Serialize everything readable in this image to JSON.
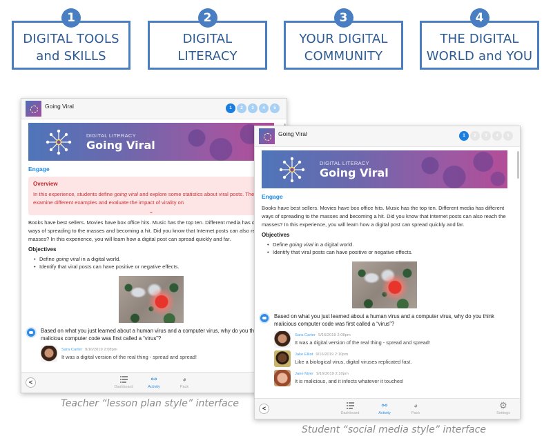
{
  "units": [
    {
      "number": "1",
      "line1": "DIGITAL TOOLS",
      "line2": "and SKILLS"
    },
    {
      "number": "2",
      "line1": "DIGITAL",
      "line2": "LITERACY"
    },
    {
      "number": "3",
      "line1": "YOUR DIGITAL",
      "line2": "COMMUNITY"
    },
    {
      "number": "4",
      "line1": "THE DIGITAL",
      "line2": "WORLD and YOU"
    }
  ],
  "colors": {
    "unit_border": "#4a7ec2",
    "accent_blue": "#1f8ae6",
    "overview_bg": "#fde5e6",
    "overview_text": "#cc3339"
  },
  "lesson": {
    "title": "Going Viral",
    "hero_kicker": "DIGITAL LITERACY",
    "hero_title": "Going Viral",
    "steps": [
      "1",
      "2",
      "3",
      "4",
      "5"
    ],
    "active_step": "1",
    "section": "Engage",
    "overview_heading": "Overview",
    "overview_text_before": "In this experience, students define ",
    "overview_text_em": "going viral",
    "overview_text_after": " and explore some statistics about viral posts. Then they examine different examples and evaluate the impact of virality on",
    "intro": "Books have best sellers. Movies have box office hits. Music has the top ten. Different media has different ways of spreading to the masses and becoming a hit. Did you know that Internet posts can also reach the masses? In this experience, you will learn how a digital post can spread quickly and far.",
    "objectives_heading": "Objectives",
    "objective1_before": "Define ",
    "objective1_em": "going viral",
    "objective1_after": " in a digital world.",
    "objective2": "Identify that viral posts can have positive or negative effects.",
    "prompt": "Based on what you just learned about a human virus and a computer virus, why do you think malicious computer code was first called a “virus”?",
    "replies": [
      {
        "name": "Sara Carter",
        "time": "9/16/2019  2:08pm",
        "text": "It was a digital version of the real thing - spread and spread!"
      },
      {
        "name": "Jake Elliot",
        "time": "9/16/2019  2:10pm",
        "text": "Like a biological virus, digital viruses replicated fast."
      },
      {
        "name": "Jane Myer",
        "time": "9/16/2019  2:10pm",
        "text": "It is malicious, and it infects whatever it touches!"
      }
    ]
  },
  "footer": {
    "back": "<",
    "dashboard": "Dashboard",
    "activity": "Activity",
    "pack": "Pack",
    "settings": "Settings"
  },
  "captions": {
    "teacher": "Teacher “lesson plan style” interface",
    "student": "Student “social media style” interface"
  }
}
